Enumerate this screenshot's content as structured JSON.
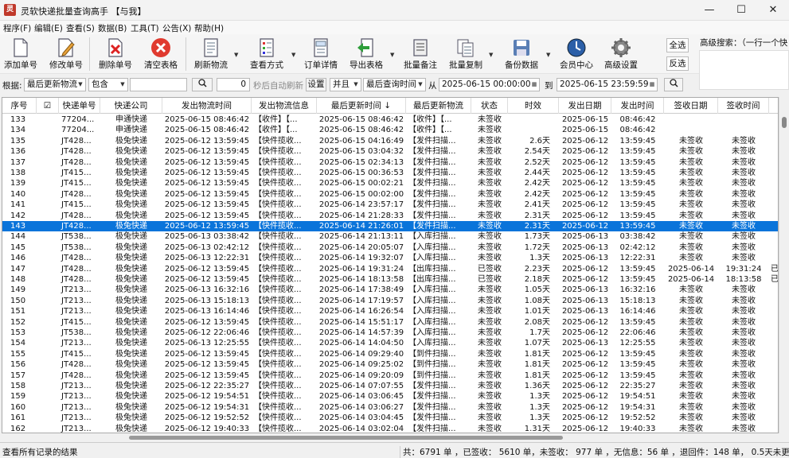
{
  "window": {
    "title": "灵软快递批量查询高手 【与我】",
    "app_icon": "app-logo-icon",
    "minimize": "—",
    "maximize": "☐",
    "close": "✕"
  },
  "menu": [
    "程序(F)",
    "编辑(E)",
    "查看(S)",
    "数据(B)",
    "工具(T)",
    "公告(X)",
    "帮助(H)"
  ],
  "toolbar": {
    "add": "添加单号",
    "edit": "修改单号",
    "delete": "删除单号",
    "clear": "清空表格",
    "refresh": "刷新物流",
    "view": "查看方式",
    "detail": "订单详情",
    "export": "导出表格",
    "batch_note": "批量备注",
    "batch_copy": "批量复制",
    "backup": "备份数据",
    "member": "会员中心",
    "settings": "高级设置",
    "select_all": "全选",
    "invert": "反选",
    "adv_search": "高级搜索：（一行一个快"
  },
  "filter": {
    "by_label": "根据:",
    "by_value": "最后更新物流",
    "match_value": "包含",
    "search_text": "",
    "seconds": "0",
    "auto_refresh": "秒后自动刷新",
    "set_btn": "设置",
    "and_value": "并且",
    "time_field": "最后查询时间",
    "from_label": "从",
    "from_date": "2025-06-15 00:00:00",
    "to_label": "到",
    "to_date": "2025-06-15 23:59:59"
  },
  "table": {
    "headers": [
      "序号",
      "☑",
      "快递单号",
      "快递公司",
      "发出物流时间",
      "发出物流信息",
      "最后更新时间 ↓",
      "最后更新物流",
      "状态",
      "时效",
      "发出日期",
      "发出时间",
      "签收日期",
      "签收时间"
    ],
    "selected_index": 10,
    "rows": [
      [
        "133",
        "",
        "77204...",
        "申通快递",
        "2025-06-15 08:46:42",
        "【收件】【...",
        "2025-06-15 08:46:42",
        "【收件】【...",
        "未签收",
        "",
        "2025-06-15",
        "08:46:42",
        "",
        "",
        ""
      ],
      [
        "134",
        "",
        "77204...",
        "申通快递",
        "2025-06-15 08:46:42",
        "【收件】【...",
        "2025-06-15 08:46:42",
        "【收件】【...",
        "未签收",
        "",
        "2025-06-15",
        "08:46:42",
        "",
        "",
        ""
      ],
      [
        "135",
        "",
        "JT428...",
        "极兔快递",
        "2025-06-12 13:59:45",
        "【快件揽收...",
        "2025-06-15 04:16:49",
        "【发件扫描...",
        "未签收",
        "2.6天",
        "2025-06-12",
        "13:59:45",
        "未签收",
        "未签收",
        ""
      ],
      [
        "136",
        "",
        "JT428...",
        "极兔快递",
        "2025-06-12 13:59:45",
        "【快件揽收...",
        "2025-06-15 03:04:32",
        "【发件扫描...",
        "未签收",
        "2.54天",
        "2025-06-12",
        "13:59:45",
        "未签收",
        "未签收",
        ""
      ],
      [
        "137",
        "",
        "JT428...",
        "极兔快递",
        "2025-06-12 13:59:45",
        "【快件揽收...",
        "2025-06-15 02:34:13",
        "【发件扫描...",
        "未签收",
        "2.52天",
        "2025-06-12",
        "13:59:45",
        "未签收",
        "未签收",
        ""
      ],
      [
        "138",
        "",
        "JT415...",
        "极兔快递",
        "2025-06-12 13:59:45",
        "【快件揽收...",
        "2025-06-15 00:36:53",
        "【发件扫描...",
        "未签收",
        "2.44天",
        "2025-06-12",
        "13:59:45",
        "未签收",
        "未签收",
        ""
      ],
      [
        "139",
        "",
        "JT415...",
        "极兔快递",
        "2025-06-12 13:59:45",
        "【快件揽收...",
        "2025-06-15 00:02:21",
        "【发件扫描...",
        "未签收",
        "2.42天",
        "2025-06-12",
        "13:59:45",
        "未签收",
        "未签收",
        ""
      ],
      [
        "140",
        "",
        "JT428...",
        "极兔快递",
        "2025-06-12 13:59:45",
        "【快件揽收...",
        "2025-06-15 00:02:00",
        "【发件扫描...",
        "未签收",
        "2.42天",
        "2025-06-12",
        "13:59:45",
        "未签收",
        "未签收",
        ""
      ],
      [
        "141",
        "",
        "JT415...",
        "极兔快递",
        "2025-06-12 13:59:45",
        "【快件揽收...",
        "2025-06-14 23:57:17",
        "【发件扫描...",
        "未签收",
        "2.41天",
        "2025-06-12",
        "13:59:45",
        "未签收",
        "未签收",
        ""
      ],
      [
        "142",
        "",
        "JT428...",
        "极兔快递",
        "2025-06-12 13:59:45",
        "【快件揽收...",
        "2025-06-14 21:28:33",
        "【发件扫描...",
        "未签收",
        "2.31天",
        "2025-06-12",
        "13:59:45",
        "未签收",
        "未签收",
        ""
      ],
      [
        "143",
        "",
        "JT428...",
        "极兔快递",
        "2025-06-12 13:59:45",
        "【快件揽收...",
        "2025-06-14 21:26:01",
        "【发件扫描...",
        "未签收",
        "2.31天",
        "2025-06-12",
        "13:59:45",
        "未签收",
        "未签收",
        ""
      ],
      [
        "144",
        "",
        "JT538...",
        "极兔快递",
        "2025-06-13 03:38:42",
        "【快件揽收...",
        "2025-06-14 21:13:11",
        "【入库扫描...",
        "未签收",
        "1.73天",
        "2025-06-13",
        "03:38:42",
        "未签收",
        "未签收",
        ""
      ],
      [
        "145",
        "",
        "JT538...",
        "极兔快递",
        "2025-06-13 02:42:12",
        "【快件揽收...",
        "2025-06-14 20:05:07",
        "【入库扫描...",
        "未签收",
        "1.72天",
        "2025-06-13",
        "02:42:12",
        "未签收",
        "未签收",
        ""
      ],
      [
        "146",
        "",
        "JT428...",
        "极兔快递",
        "2025-06-13 12:22:31",
        "【快件揽收...",
        "2025-06-14 19:32:07",
        "【入库扫描...",
        "未签收",
        "1.3天",
        "2025-06-13",
        "12:22:31",
        "未签收",
        "未签收",
        ""
      ],
      [
        "147",
        "",
        "JT428...",
        "极兔快递",
        "2025-06-12 13:59:45",
        "【快件揽收...",
        "2025-06-14 19:31:24",
        "【出库扫描...",
        "已签收",
        "2.23天",
        "2025-06-12",
        "13:59:45",
        "2025-06-14",
        "19:31:24",
        "已"
      ],
      [
        "148",
        "",
        "JT428...",
        "极兔快递",
        "2025-06-12 13:59:45",
        "【快件揽收...",
        "2025-06-14 18:13:58",
        "【出库扫描...",
        "已签收",
        "2.18天",
        "2025-06-12",
        "13:59:45",
        "2025-06-14",
        "18:13:58",
        "已"
      ],
      [
        "149",
        "",
        "JT213...",
        "极兔快递",
        "2025-06-13 16:32:16",
        "【快件揽收...",
        "2025-06-14 17:38:49",
        "【入库扫描...",
        "未签收",
        "1.05天",
        "2025-06-13",
        "16:32:16",
        "未签收",
        "未签收",
        ""
      ],
      [
        "150",
        "",
        "JT213...",
        "极兔快递",
        "2025-06-13 15:18:13",
        "【快件揽收...",
        "2025-06-14 17:19:57",
        "【入库扫描...",
        "未签收",
        "1.08天",
        "2025-06-13",
        "15:18:13",
        "未签收",
        "未签收",
        ""
      ],
      [
        "151",
        "",
        "JT213...",
        "极兔快递",
        "2025-06-13 16:14:46",
        "【快件揽收...",
        "2025-06-14 16:26:54",
        "【入库扫描...",
        "未签收",
        "1.01天",
        "2025-06-13",
        "16:14:46",
        "未签收",
        "未签收",
        ""
      ],
      [
        "152",
        "",
        "JT415...",
        "极兔快递",
        "2025-06-12 13:59:45",
        "【快件揽收...",
        "2025-06-14 15:51:17",
        "【入库扫描...",
        "未签收",
        "2.08天",
        "2025-06-12",
        "13:59:45",
        "未签收",
        "未签收",
        ""
      ],
      [
        "153",
        "",
        "JT538...",
        "极兔快递",
        "2025-06-12 22:06:46",
        "【快件揽收...",
        "2025-06-14 14:57:39",
        "【入库扫描...",
        "未签收",
        "1.7天",
        "2025-06-12",
        "22:06:46",
        "未签收",
        "未签收",
        ""
      ],
      [
        "154",
        "",
        "JT213...",
        "极兔快递",
        "2025-06-13 12:25:55",
        "【快件揽收...",
        "2025-06-14 14:04:50",
        "【入库扫描...",
        "未签收",
        "1.07天",
        "2025-06-13",
        "12:25:55",
        "未签收",
        "未签收",
        ""
      ],
      [
        "155",
        "",
        "JT415...",
        "极兔快递",
        "2025-06-12 13:59:45",
        "【快件揽收...",
        "2025-06-14 09:29:40",
        "【到件扫描...",
        "未签收",
        "1.81天",
        "2025-06-12",
        "13:59:45",
        "未签收",
        "未签收",
        ""
      ],
      [
        "156",
        "",
        "JT428...",
        "极兔快递",
        "2025-06-12 13:59:45",
        "【快件揽收...",
        "2025-06-14 09:25:02",
        "【到件扫描...",
        "未签收",
        "1.81天",
        "2025-06-12",
        "13:59:45",
        "未签收",
        "未签收",
        ""
      ],
      [
        "157",
        "",
        "JT428...",
        "极兔快递",
        "2025-06-12 13:59:45",
        "【快件揽收...",
        "2025-06-14 09:20:09",
        "【到件扫描...",
        "未签收",
        "1.81天",
        "2025-06-12",
        "13:59:45",
        "未签收",
        "未签收",
        ""
      ],
      [
        "158",
        "",
        "JT213...",
        "极兔快递",
        "2025-06-12 22:35:27",
        "【快件揽收...",
        "2025-06-14 07:07:55",
        "【发件扫描...",
        "未签收",
        "1.36天",
        "2025-06-12",
        "22:35:27",
        "未签收",
        "未签收",
        ""
      ],
      [
        "159",
        "",
        "JT213...",
        "极兔快递",
        "2025-06-12 19:54:51",
        "【快件揽收...",
        "2025-06-14 03:06:45",
        "【发件扫描...",
        "未签收",
        "1.3天",
        "2025-06-12",
        "19:54:51",
        "未签收",
        "未签收",
        ""
      ],
      [
        "160",
        "",
        "JT213...",
        "极兔快递",
        "2025-06-12 19:54:31",
        "【快件揽收...",
        "2025-06-14 03:06:27",
        "【发件扫描...",
        "未签收",
        "1.3天",
        "2025-06-12",
        "19:54:31",
        "未签收",
        "未签收",
        ""
      ],
      [
        "161",
        "",
        "JT213...",
        "极兔快递",
        "2025-06-12 19:52:52",
        "【快件揽收...",
        "2025-06-14 03:04:45",
        "【发件扫描...",
        "未签收",
        "1.3天",
        "2025-06-12",
        "19:52:52",
        "未签收",
        "未签收",
        ""
      ],
      [
        "162",
        "",
        "JT213...",
        "极兔快递",
        "2025-06-12 19:40:33",
        "【快件揽收...",
        "2025-06-14 03:02:04",
        "【发件扫描...",
        "未签收",
        "1.31天",
        "2025-06-12",
        "19:40:33",
        "未签收",
        "未签收",
        ""
      ]
    ]
  },
  "status": {
    "left": "查看所有记录的结果",
    "right": "共：6791 单 ，已签收： 5610 单，未签收： 977 单 ，无信息：56 单 ，退回件：148 单， 0.5天未更新：18"
  },
  "colors": {
    "selection": "#0a74da"
  }
}
